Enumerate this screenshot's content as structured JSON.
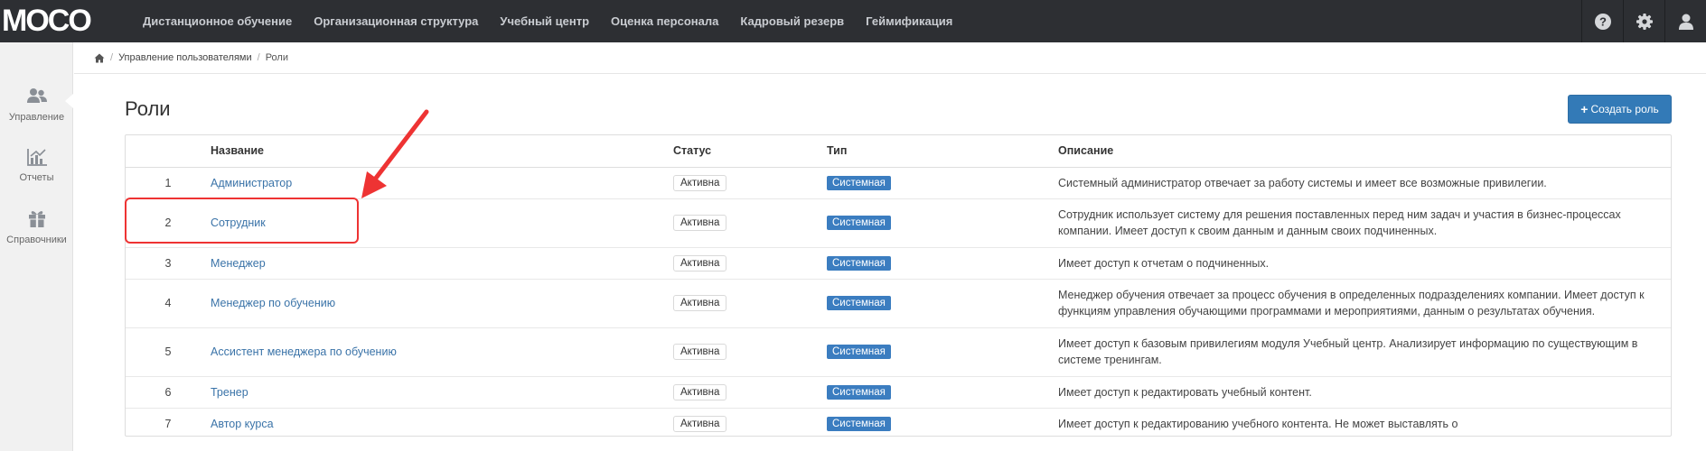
{
  "app": {
    "logo": "MOCO",
    "nav": [
      "Дистанционное обучение",
      "Организационная структура",
      "Учебный центр",
      "Оценка персонала",
      "Кадровый резерв",
      "Геймификация"
    ]
  },
  "sidebar": {
    "items": [
      {
        "label": "Управление",
        "icon": "users-icon"
      },
      {
        "label": "Отчеты",
        "icon": "bar-chart-icon"
      },
      {
        "label": "Справочники",
        "icon": "gift-icon"
      }
    ]
  },
  "breadcrumb": {
    "items": [
      "Управление пользователями",
      "Роли"
    ]
  },
  "page": {
    "title": "Роли",
    "create_label": "Создать роль"
  },
  "table": {
    "headers": [
      "Название",
      "Статус",
      "Тип",
      "Описание"
    ],
    "rows": [
      {
        "num": "1",
        "name": "Администратор",
        "status": "Активна",
        "type": "Системная",
        "desc": "Системный администратор отвечает за работу системы и имеет все возможные привилегии."
      },
      {
        "num": "2",
        "name": "Сотрудник",
        "status": "Активна",
        "type": "Системная",
        "desc": "Сотрудник использует систему для решения поставленных перед ним задач и участия в бизнес-процессах компании. Имеет доступ к своим данным и данным своих подчиненных."
      },
      {
        "num": "3",
        "name": "Менеджер",
        "status": "Активна",
        "type": "Системная",
        "desc": "Имеет доступ к отчетам о подчиненных."
      },
      {
        "num": "4",
        "name": "Менеджер по обучению",
        "status": "Активна",
        "type": "Системная",
        "desc": "Менеджер обучения отвечает за процесс обучения в определенных подразделениях компании. Имеет доступ к функциям управления обучающими программами и мероприятиями, данным о результатах обучения."
      },
      {
        "num": "5",
        "name": "Ассистент менеджера по обучению",
        "status": "Активна",
        "type": "Системная",
        "desc": "Имеет доступ к базовым привилегиям модуля Учебный центр. Анализирует информацию по существующим в системе тренингам."
      },
      {
        "num": "6",
        "name": "Тренер",
        "status": "Активна",
        "type": "Системная",
        "desc": "Имеет доступ к редактировать учебный контент."
      },
      {
        "num": "7",
        "name": "Автор курса",
        "status": "Активна",
        "type": "Системная",
        "desc": "Имеет доступ к редактированию учебного контента. Не может выставлять о"
      }
    ]
  },
  "colors": {
    "topbar": "#2d2f33",
    "link": "#3a73a8",
    "badge": "#3b7dc0",
    "primary_button": "#337ab7",
    "annotation": "#e33333"
  }
}
